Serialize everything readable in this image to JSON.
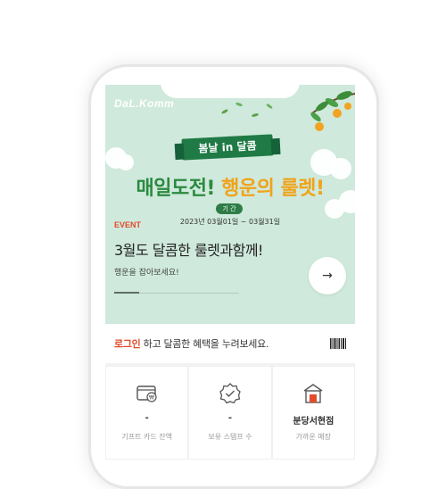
{
  "banner": {
    "logo": "DaL.Komm",
    "ribbon_text": "봄날 in 달콤",
    "headline_part1": "매일도전! ",
    "headline_part2": "행운의 룰렛!",
    "period_label": "기 간",
    "period_dates": "2023년 03월01일 ~ 03월31일",
    "event_label": "EVENT",
    "event_title": "3월도 달콤한 룰렛과함께!",
    "event_subtitle": "행운을 잡아보세요!",
    "arrow_icon": "→",
    "slide_progress": 0.2
  },
  "login": {
    "link_text": "로그인",
    "message": " 하고 달콤한 혜택을 누려보세요."
  },
  "quick_menu": [
    {
      "icon": "gift-card-icon",
      "value": "-",
      "label": "기프트 카드 잔액"
    },
    {
      "icon": "stamp-badge-icon",
      "value": "-",
      "label": "보유 스탬프 수"
    },
    {
      "icon": "store-icon",
      "value": "분당서현점",
      "label": "가까운 매장"
    }
  ],
  "colors": {
    "banner_bg": "#cfe9dc",
    "accent_red": "#e24b2b",
    "headline_green": "#2c8a3f",
    "headline_orange": "#f0a31b"
  }
}
